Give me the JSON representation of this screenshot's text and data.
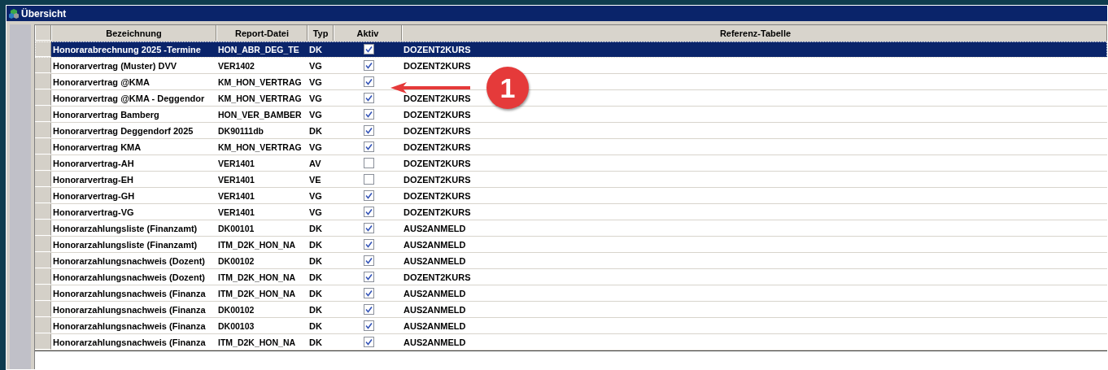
{
  "window": {
    "title": "Übersicht"
  },
  "table": {
    "columns": [
      "Bezeichnung",
      "Report-Datei",
      "Typ",
      "Aktiv",
      "Referenz-Tabelle"
    ],
    "rows": [
      {
        "name": "Honorarabrechnung 2025 -Termine",
        "report": "HON_ABR_DEG_TE",
        "typ": "DK",
        "checked": true,
        "ref": "DOZENT2KURS",
        "selected": true
      },
      {
        "name": "Honorarvertrag (Muster) DVV",
        "report": "VER1402",
        "typ": "VG",
        "checked": true,
        "ref": "DOZENT2KURS",
        "selected": false
      },
      {
        "name": "Honorarvertrag @KMA",
        "report": "KM_HON_VERTRAG",
        "typ": "VG",
        "checked": true,
        "selected": false
      },
      {
        "name": "Honorarvertrag @KMA - Deggendor",
        "report": "KM_HON_VERTRAG",
        "typ": "VG",
        "checked": true,
        "ref": "DOZENT2KURS",
        "selected": false
      },
      {
        "name": "Honorarvertrag Bamberg",
        "report": "HON_VER_BAMBER",
        "typ": "VG",
        "checked": true,
        "ref": "DOZENT2KURS",
        "selected": false
      },
      {
        "name": "Honorarvertrag Deggendorf 2025",
        "report": "DK90111db",
        "typ": "DK",
        "checked": true,
        "ref": "DOZENT2KURS",
        "selected": false
      },
      {
        "name": "Honorarvertrag KMA",
        "report": "KM_HON_VERTRAG",
        "typ": "VG",
        "checked": true,
        "ref": "DOZENT2KURS",
        "selected": false
      },
      {
        "name": "Honorarvertrag-AH",
        "report": "VER1401",
        "typ": "AV",
        "checked": false,
        "ref": "DOZENT2KURS",
        "selected": false
      },
      {
        "name": "Honorarvertrag-EH",
        "report": "VER1401",
        "typ": "VE",
        "checked": false,
        "ref": "DOZENT2KURS",
        "selected": false
      },
      {
        "name": "Honorarvertrag-GH",
        "report": "VER1401",
        "typ": "VG",
        "checked": true,
        "ref": "DOZENT2KURS",
        "selected": false
      },
      {
        "name": "Honorarvertrag-VG",
        "report": "VER1401",
        "typ": "VG",
        "checked": true,
        "ref": "DOZENT2KURS",
        "selected": false
      },
      {
        "name": "Honorarzahlungsliste (Finanzamt)",
        "report": "DK00101",
        "typ": "DK",
        "checked": true,
        "ref": "AUS2ANMELD",
        "selected": false
      },
      {
        "name": "Honorarzahlungsliste (Finanzamt)",
        "report": "ITM_D2K_HON_NA",
        "typ": "DK",
        "checked": true,
        "ref": "AUS2ANMELD",
        "selected": false
      },
      {
        "name": "Honorarzahlungsnachweis (Dozent)",
        "report": "DK00102",
        "typ": "DK",
        "checked": true,
        "ref": "AUS2ANMELD",
        "selected": false
      },
      {
        "name": "Honorarzahlungsnachweis (Dozent)",
        "report": "ITM_D2K_HON_NA",
        "typ": "DK",
        "checked": true,
        "ref": "DOZENT2KURS",
        "selected": false
      },
      {
        "name": "Honorarzahlungsnachweis (Finanza",
        "report": "ITM_D2K_HON_NA",
        "typ": "DK",
        "checked": true,
        "ref": "AUS2ANMELD",
        "selected": false
      },
      {
        "name": "Honorarzahlungsnachweis (Finanza",
        "report": "DK00102",
        "typ": "DK",
        "checked": true,
        "ref": "AUS2ANMELD",
        "selected": false
      },
      {
        "name": "Honorarzahlungsnachweis (Finanza",
        "report": "DK00103",
        "typ": "DK",
        "checked": true,
        "ref": "AUS2ANMELD",
        "selected": false
      },
      {
        "name": "Honorarzahlungsnachweis (Finanza",
        "report": "ITM_D2K_HON_NA",
        "typ": "DK",
        "checked": true,
        "ref": "AUS2ANMELD",
        "selected": false
      }
    ]
  },
  "annotation": {
    "number": "1"
  }
}
